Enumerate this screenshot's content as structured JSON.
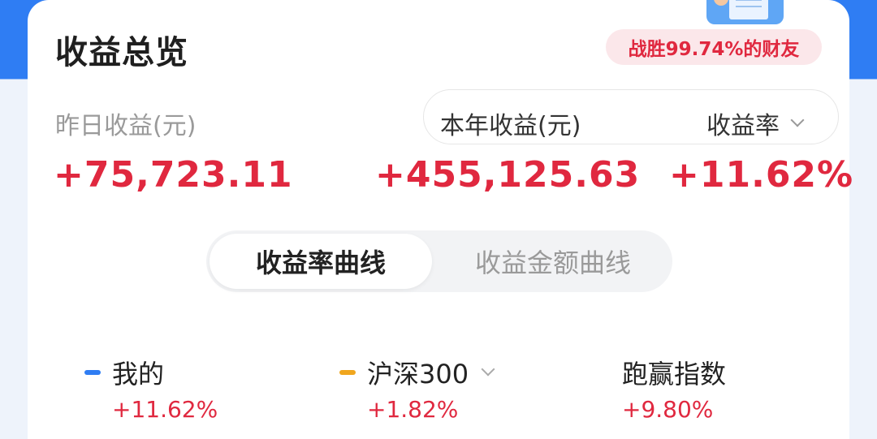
{
  "colors": {
    "accent_red": "#e0283f",
    "brand_blue": "#2f7df3",
    "mine_line": "#2f7df3",
    "hs300_line": "#f0a61e"
  },
  "header": {
    "title": "收益总览",
    "badge": "战胜99.74%的财友"
  },
  "yesterday": {
    "label": "昨日收益(元)",
    "value": "+75,723.11"
  },
  "year": {
    "label": "本年收益(元)",
    "value": "+455,125.63"
  },
  "rate": {
    "selector_label": "收益率",
    "value": "+11.62%",
    "selector_icon": "chevron-down-icon"
  },
  "tabs": [
    {
      "label": "收益率曲线",
      "active": true
    },
    {
      "label": "收益金额曲线",
      "active": false
    }
  ],
  "legend": [
    {
      "name": "我的",
      "value": "+11.62%"
    },
    {
      "name": "沪深300",
      "value": "+1.82%"
    },
    {
      "name": "跑赢指数",
      "value": "+9.80%"
    }
  ]
}
